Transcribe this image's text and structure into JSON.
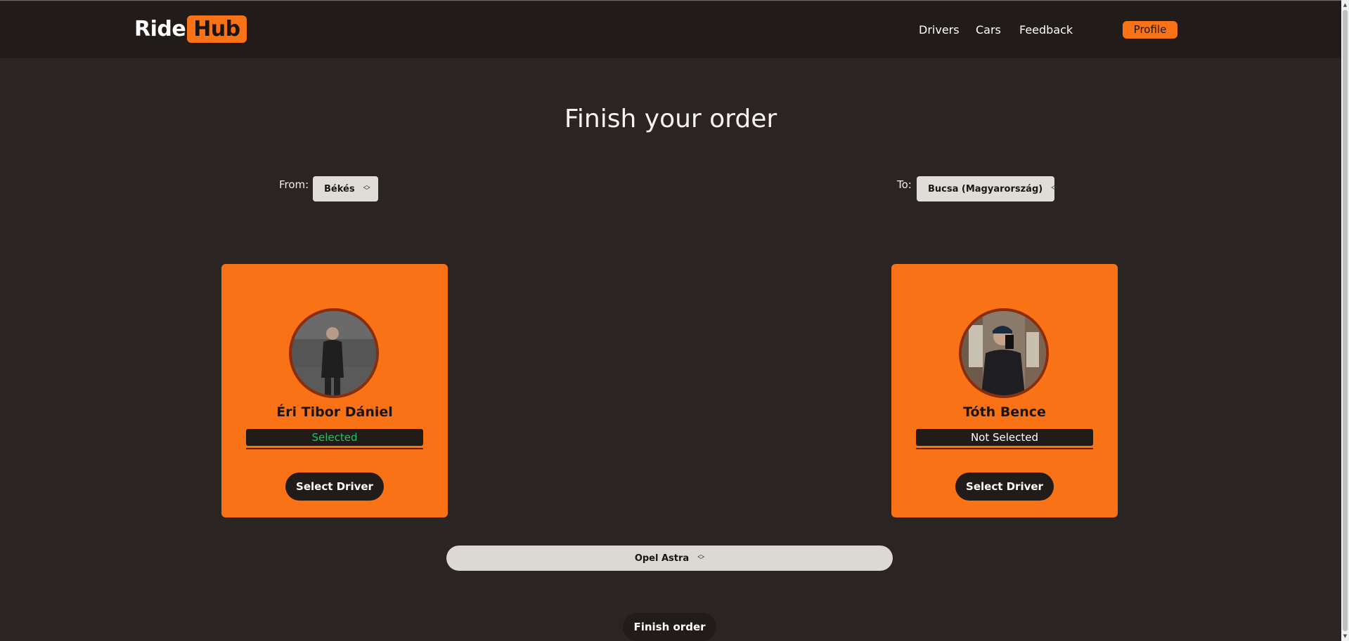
{
  "brand": {
    "word": "Ride",
    "badge": "Hub",
    "accent_color": "#f97316"
  },
  "nav": {
    "drivers": "Drivers",
    "cars": "Cars",
    "feedback": "Feedback",
    "profile": "Profile"
  },
  "page": {
    "title": "Finish your order"
  },
  "route": {
    "from_label": "From:",
    "from_value": "Békés",
    "to_label": "To:",
    "to_value": "Bucsa (Magyarország)"
  },
  "drivers": [
    {
      "name": "Éri Tibor Dániel",
      "status": "Selected",
      "status_color": "#22c55e",
      "button": "Select Driver"
    },
    {
      "name": "Tóth Bence",
      "status": "Not Selected",
      "status_color": "#ffffff",
      "button": "Select Driver"
    }
  ],
  "car": {
    "value": "Opel Astra"
  },
  "finish": {
    "label": "Finish order"
  },
  "icons": {
    "select_chevrons": "chevron-up-down-icon",
    "scroll_up": "triangle-up",
    "scroll_down": "triangle-down"
  }
}
